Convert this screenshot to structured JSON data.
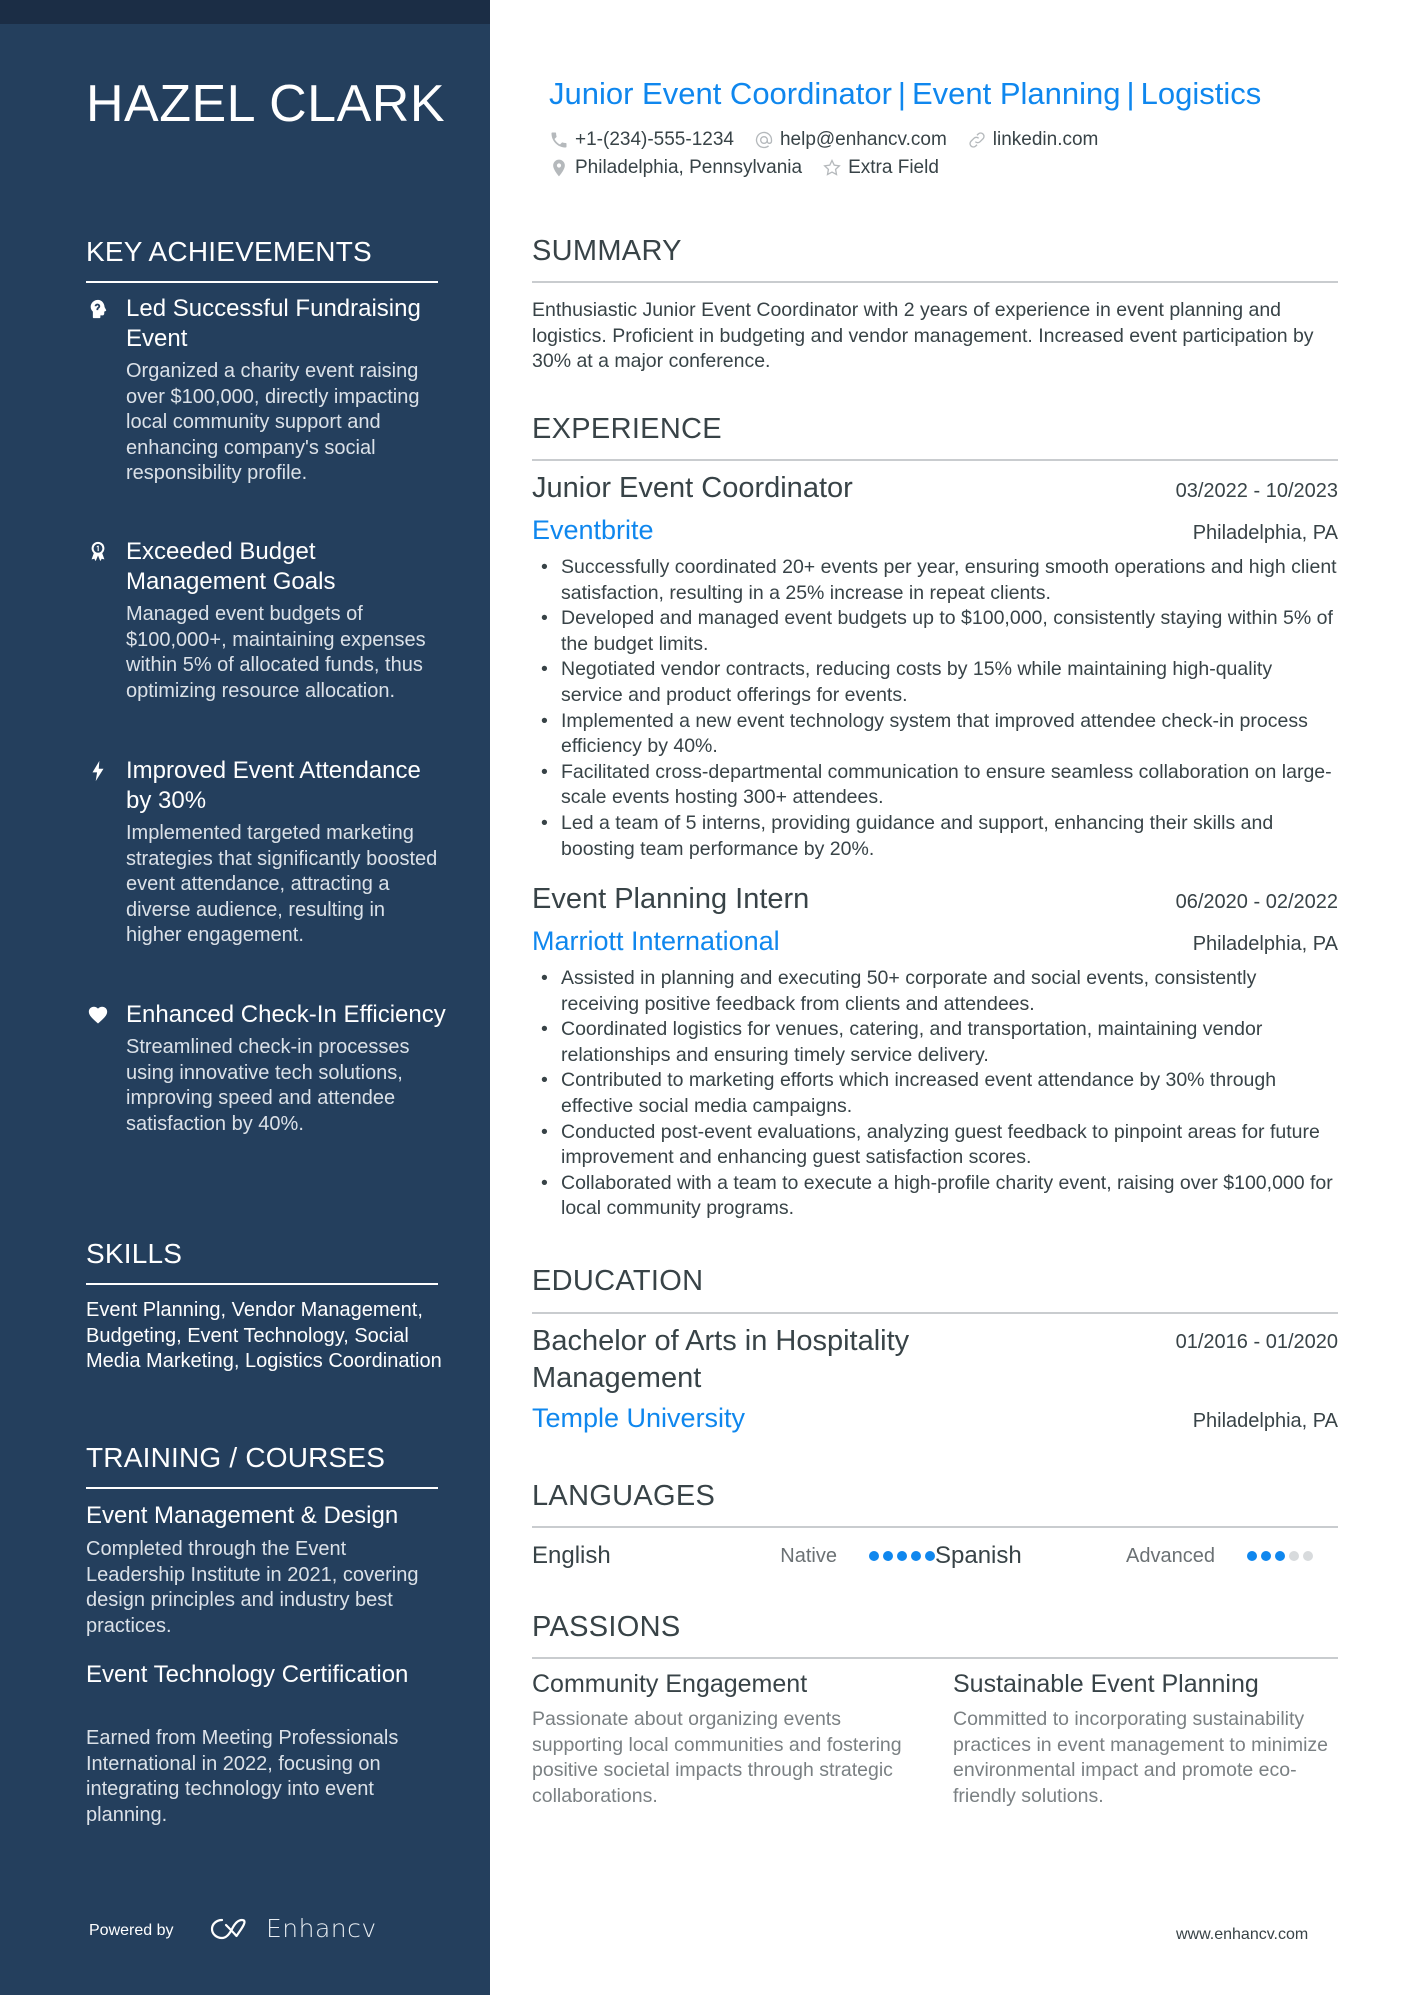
{
  "name": "HAZEL CLARK",
  "headline": {
    "parts": [
      "Junior Event Coordinator",
      "Event Planning",
      "Logistics"
    ],
    "separator": "|"
  },
  "contact": {
    "phone": "+1-(234)-555-1234",
    "email": "help@enhancv.com",
    "website": "linkedin.com",
    "location": "Philadelphia, Pennsylvania",
    "extra": "Extra Field"
  },
  "sidebar": {
    "achievements": {
      "heading": "KEY ACHIEVEMENTS",
      "items": [
        {
          "icon": "brain-head-icon",
          "title": "Led Successful Fundraising Event",
          "desc": "Organized a charity event raising over $100,000, directly impacting local community support and enhancing company's social responsibility profile."
        },
        {
          "icon": "award-ribbon-icon",
          "title": "Exceeded Budget Management Goals",
          "desc": "Managed event budgets of $100,000+, maintaining expenses within 5% of allocated funds, thus optimizing resource allocation."
        },
        {
          "icon": "lightning-bolt-icon",
          "title": "Improved Event Attendance by 30%",
          "desc": "Implemented targeted marketing strategies that significantly boosted event attendance, attracting a diverse audience, resulting in higher engagement."
        },
        {
          "icon": "heart-icon",
          "title": "Enhanced Check-In Efficiency",
          "desc": "Streamlined check-in processes using innovative tech solutions, improving speed and attendee satisfaction by 40%."
        }
      ]
    },
    "skills": {
      "heading": "SKILLS",
      "text": "Event Planning, Vendor Management, Budgeting, Event Technology, Social Media Marketing, Logistics Coordination"
    },
    "training": {
      "heading": "TRAINING / COURSES",
      "items": [
        {
          "title": "Event Management & Design",
          "desc": "Completed through the Event Leadership Institute in 2021, covering design principles and industry best practices."
        },
        {
          "title": "Event Technology Certification",
          "desc": "Earned from Meeting Professionals International in 2022, focusing on integrating technology into event planning."
        }
      ]
    },
    "footer": {
      "powered_by": "Powered by",
      "brand": "Enhancv"
    }
  },
  "summary": {
    "heading": "SUMMARY",
    "text": "Enthusiastic Junior Event Coordinator with 2 years of experience in event planning and logistics. Proficient in budgeting and vendor management. Increased event participation by 30% at a major conference."
  },
  "experience": {
    "heading": "EXPERIENCE",
    "jobs": [
      {
        "title": "Junior Event Coordinator",
        "dates": "03/2022 - 10/2023",
        "company": "Eventbrite",
        "location": "Philadelphia, PA",
        "bullets": [
          "Successfully coordinated 20+ events per year, ensuring smooth operations and high client satisfaction, resulting in a 25% increase in repeat clients.",
          "Developed and managed event budgets up to $100,000, consistently staying within 5% of the budget limits.",
          "Negotiated vendor contracts, reducing costs by 15% while maintaining high-quality service and product offerings for events.",
          "Implemented a new event technology system that improved attendee check-in process efficiency by 40%.",
          "Facilitated cross-departmental communication to ensure seamless collaboration on large-scale events hosting 300+ attendees.",
          "Led a team of 5 interns, providing guidance and support, enhancing their skills and boosting team performance by 20%."
        ]
      },
      {
        "title": "Event Planning Intern",
        "dates": "06/2020 - 02/2022",
        "company": "Marriott International",
        "location": "Philadelphia, PA",
        "bullets": [
          "Assisted in planning and executing 50+ corporate and social events, consistently receiving positive feedback from clients and attendees.",
          "Coordinated logistics for venues, catering, and transportation, maintaining vendor relationships and ensuring timely service delivery.",
          "Contributed to marketing efforts which increased event attendance by 30% through effective social media campaigns.",
          "Conducted post-event evaluations, analyzing guest feedback to pinpoint areas for future improvement and enhancing guest satisfaction scores.",
          "Collaborated with a team to execute a high-profile charity event, raising over $100,000 for local community programs."
        ]
      }
    ]
  },
  "education": {
    "heading": "EDUCATION",
    "items": [
      {
        "degree": "Bachelor of Arts in Hospitality Management",
        "dates": "01/2016 - 01/2020",
        "school": "Temple University",
        "location": "Philadelphia, PA"
      }
    ]
  },
  "languages": {
    "heading": "LANGUAGES",
    "items": [
      {
        "name": "English",
        "level": "Native",
        "rating": 5,
        "max": 5
      },
      {
        "name": "Spanish",
        "level": "Advanced",
        "rating": 3,
        "max": 5
      }
    ]
  },
  "passions": {
    "heading": "PASSIONS",
    "items": [
      {
        "title": "Community Engagement",
        "desc": "Passionate about organizing events supporting local communities and fostering positive societal impacts through strategic collaborations."
      },
      {
        "title": "Sustainable Event Planning",
        "desc": "Committed to incorporating sustainability practices in event management to minimize environmental impact and promote eco-friendly solutions."
      }
    ]
  },
  "footer": {
    "url": "www.enhancv.com"
  },
  "colors": {
    "sidebar": "#243f5d",
    "sidebar_strip": "#1b2d45",
    "accent": "#0f87ee",
    "text": "#384347",
    "rule": "#c9cccf"
  }
}
